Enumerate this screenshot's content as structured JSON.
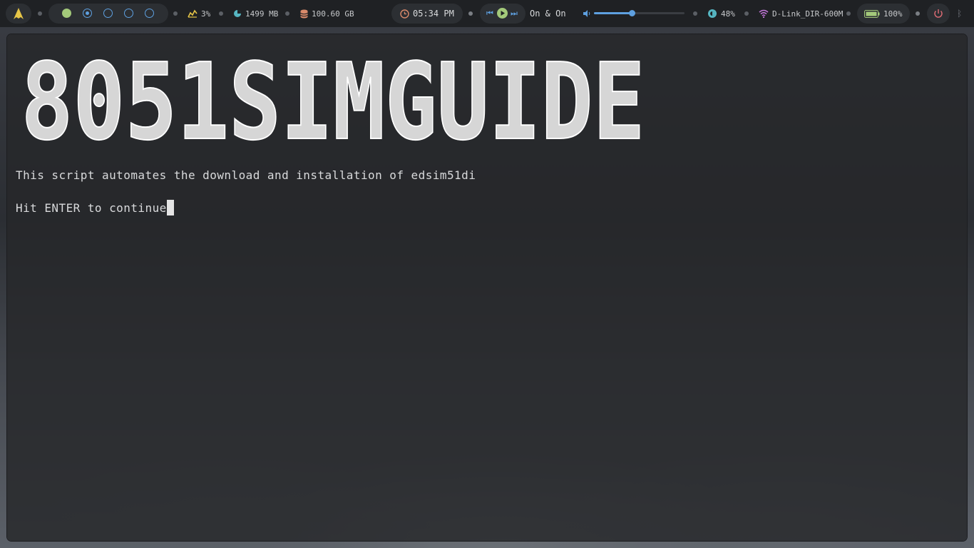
{
  "topbar": {
    "launcher_icon": "arch-logo-icon",
    "workspaces": [
      "active",
      "current",
      "empty",
      "empty",
      "empty"
    ],
    "cpu": {
      "icon": "cpu-graph-icon",
      "value": "3%"
    },
    "memory": {
      "icon": "memory-pie-icon",
      "value": "1499 MB"
    },
    "disk": {
      "icon": "database-icon",
      "value": "100.60 GB"
    },
    "clock": {
      "icon": "clock-icon",
      "value": "05:34 PM"
    },
    "media": {
      "track": "On & On",
      "prev_icon": "skip-back-icon",
      "play_icon": "play-icon",
      "next_icon": "skip-forward-icon"
    },
    "volume": {
      "icon": "speaker-icon",
      "level": 0.42
    },
    "brightness": {
      "icon": "brightness-icon",
      "value": "48%"
    },
    "network": {
      "icon": "wifi-icon",
      "value": "D-Link_DIR-600M"
    },
    "battery": {
      "icon": "battery-icon",
      "value": "100%"
    },
    "power_icon": "power-icon",
    "bluetooth_icon": "bluetooth-icon"
  },
  "terminal": {
    "banner_text": "8051SIMGUIDE",
    "line1": "This script automates the download and installation of edsim51di",
    "line2": "Hit ENTER to continue"
  },
  "colors": {
    "accent": "#5ea0e0",
    "workspace_active": "#a3c97a",
    "bar_bg": "#1f2124",
    "terminal_text": "#d9dadc",
    "power": "#e06c75"
  }
}
